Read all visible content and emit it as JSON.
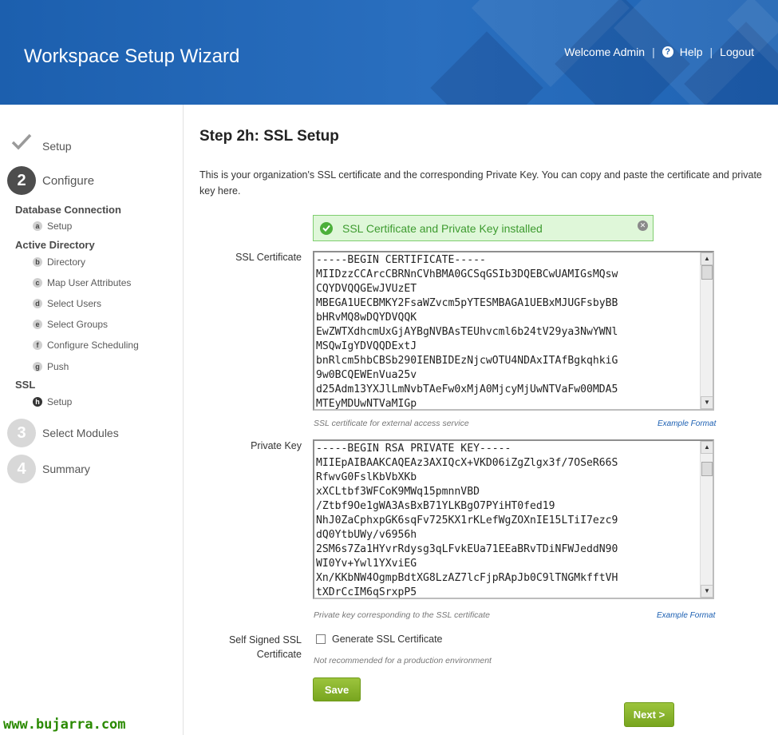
{
  "header": {
    "title": "Workspace Setup Wizard",
    "welcome": "Welcome Admin",
    "help": "Help",
    "logout": "Logout",
    "separator": "|"
  },
  "sidebar": {
    "steps": [
      {
        "number": "",
        "label": "Setup",
        "state": "done"
      },
      {
        "number": "2",
        "label": "Configure",
        "state": "active"
      },
      {
        "number": "3",
        "label": "Select Modules",
        "state": "inactive"
      },
      {
        "number": "4",
        "label": "Summary",
        "state": "inactive"
      }
    ],
    "groups": {
      "database": {
        "title": "Database Connection",
        "items": [
          {
            "badge": "a",
            "label": "Setup"
          }
        ]
      },
      "active_directory": {
        "title": "Active Directory",
        "items": [
          {
            "badge": "b",
            "label": "Directory"
          },
          {
            "badge": "c",
            "label": "Map User Attributes"
          },
          {
            "badge": "d",
            "label": "Select Users"
          },
          {
            "badge": "e",
            "label": "Select Groups"
          },
          {
            "badge": "f",
            "label": "Configure Scheduling"
          },
          {
            "badge": "g",
            "label": "Push"
          }
        ]
      },
      "ssl": {
        "title": "SSL",
        "items": [
          {
            "badge": "h",
            "label": "Setup",
            "active": true
          }
        ]
      }
    }
  },
  "main": {
    "title": "Step 2h: SSL Setup",
    "intro": "This is your organization's SSL certificate and the corresponding Private Key. You can copy and paste the certificate and private key here.",
    "success_message": "SSL Certificate and Private Key installed",
    "ssl_certificate": {
      "label": "SSL Certificate",
      "value": "-----BEGIN CERTIFICATE-----\nMIIDzzCCArcCBRNnCVhBMA0GCSqGSIb3DQEBCwUAMIGsMQsw\nCQYDVQQGEwJVUzET\nMBEGA1UECBMKY2FsaWZvcm5pYTESMBAGA1UEBxMJUGFsbyBB\nbHRvMQ8wDQYDVQQK\nEwZWTXdhcmUxGjAYBgNVBAsTEUhvcml6b24tV29ya3NwYWNl\nMSQwIgYDVQQDExtJ\nbnRlcm5hbCBSb290IENBIDEzNjcwOTU4NDAxITAfBgkqhkiG\n9w0BCQEWEnVua25v\nd25Adm13YXJlLmNvbTAeFw0xMjA0MjcyMjUwNTVaFw00MDA5\nMTEyMDUwNTVaMIGp",
      "hint": "SSL certificate for external access service",
      "example": "Example Format"
    },
    "private_key": {
      "label": "Private Key",
      "value": "-----BEGIN RSA PRIVATE KEY-----\nMIIEpAIBAAKCAQEAz3AXIQcX+VKD06iZgZlgx3f/7OSeR66S\nRfwvG0FslKbVbXKb\nxXCLtbf3WFCoK9MWq15pmnnVBD\n/Ztbf9Oe1gWA3AsBxB71YLKBgO7PYiHT0fed19\nNhJ0ZaCphxpGK6sqFv725KX1rKLefWgZOXnIE15LTiI7ezc9\ndQ0YtbUWy/v6956h\n2SM6s7Za1HYvrRdysg3qLFvkEUa71EEaBRvTDiNFWJeddN90\nWI0Yv+Ywl1YXviEG\nXn/KKbNW4OgmpBdtXG8LzAZ7lcFjpRApJb0C9lTNGMkfftVH\ntXDrCcIM6qSrxpP5",
      "hint": "Private key corresponding to the SSL certificate",
      "example": "Example Format"
    },
    "self_signed": {
      "label_line1": "Self Signed SSL",
      "label_line2": "Certificate",
      "checkbox_label": "Generate SSL Certificate",
      "checked": false,
      "hint": "Not recommended for a production environment"
    },
    "save_label": "Save",
    "next_label": "Next >"
  },
  "watermark": "www.bujarra.com",
  "colors": {
    "header_blue": "#1c5fae",
    "button_green": "#8ab52e",
    "success_green": "#4caf3a",
    "link_blue": "#1b5fb2"
  }
}
